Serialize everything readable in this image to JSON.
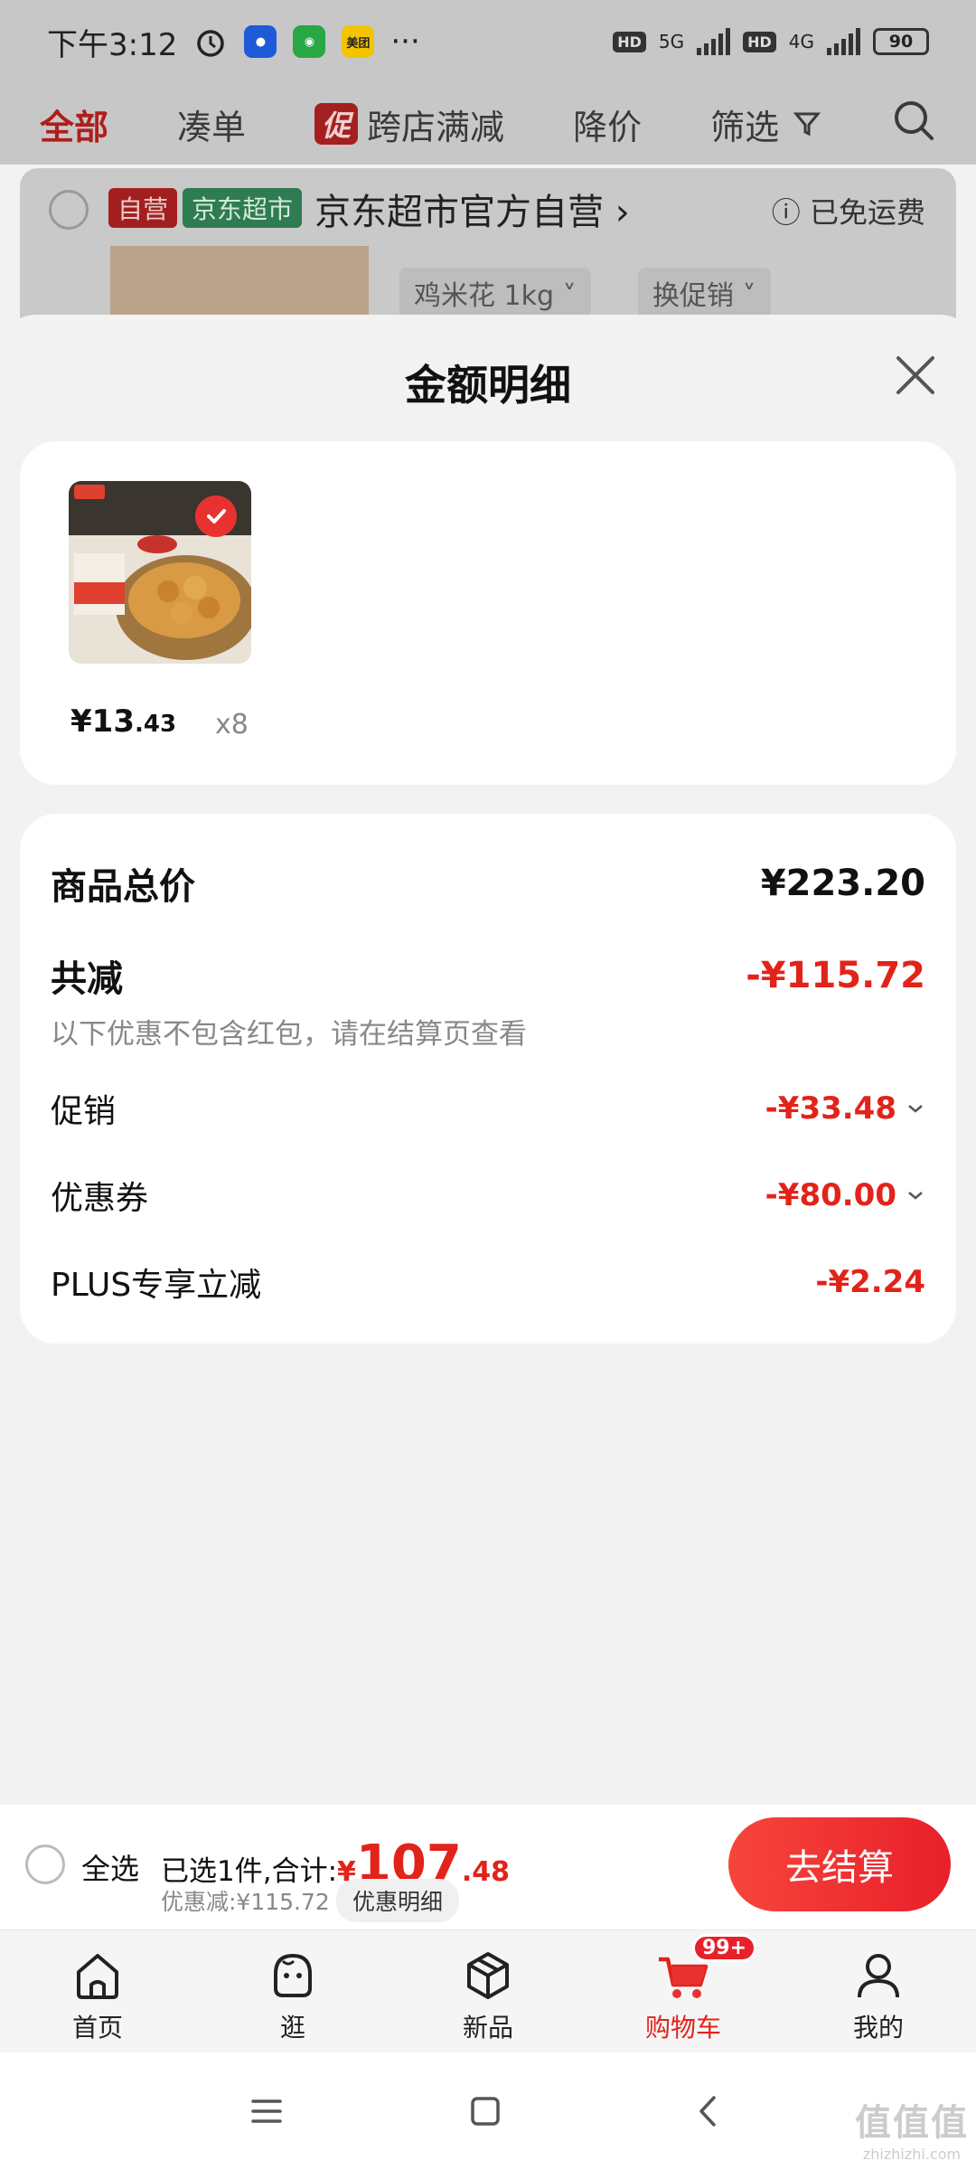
{
  "status_bar": {
    "time": "下午3:12",
    "more": "···",
    "meituan": "美团",
    "hd": "HD",
    "net1": "5G",
    "net2": "4G",
    "battery": "90"
  },
  "top_tabs": {
    "all": "全部",
    "bundle": "凑单",
    "promo_tag": "促",
    "cross_store": "跨店满减",
    "price_drop": "降价",
    "filter": "筛选"
  },
  "store": {
    "tag_self": "自营",
    "tag_market": "京东超市",
    "name": "京东超市官方自营",
    "shipping": "已免运费",
    "sku": "鸡米花 1kg",
    "promo": "换促销"
  },
  "sheet": {
    "title": "金额明细",
    "item": {
      "price_int": "¥13",
      "price_dec": ".43",
      "qty": "x8"
    },
    "summary": {
      "total_label": "商品总价",
      "total_value": "¥223.20",
      "reduce_label": "共减",
      "reduce_value": "-¥115.72",
      "note": "以下优惠不包含红包，请在结算页查看",
      "promo_label": "促销",
      "promo_value": "-¥33.48",
      "coupon_label": "优惠券",
      "coupon_value": "-¥80.00",
      "plus_label": "PLUS专享立减",
      "plus_value": "-¥2.24"
    }
  },
  "checkout": {
    "select_all": "全选",
    "selected_text": "已选1件,合计:",
    "yen": "¥",
    "total_int": "107",
    "total_dec": ".48",
    "saved": "优惠减:¥115.72",
    "detail": "优惠明细",
    "pay": "去结算"
  },
  "tabbar": {
    "home": "首页",
    "browse": "逛",
    "new": "新品",
    "cart": "购物车",
    "cart_badge": "99+",
    "mine": "我的"
  },
  "watermark": {
    "line1": "值值值",
    "line2": "zhizhizhi.com"
  },
  "colors": {
    "accent": "#e2231a",
    "overlay": "#c7c7c7"
  }
}
